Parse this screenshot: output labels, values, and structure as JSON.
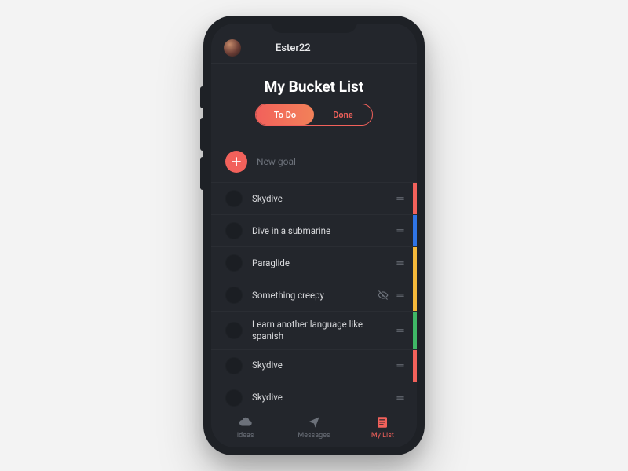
{
  "header": {
    "username": "Ester22"
  },
  "page": {
    "title": "My Bucket List"
  },
  "segments": {
    "todo": "To Do",
    "done": "Done"
  },
  "newGoal": {
    "placeholder": "New goal"
  },
  "items": [
    {
      "label": "Skydive",
      "color": "#f2615b",
      "private": false
    },
    {
      "label": "Dive in a submarine",
      "color": "#2f74e6",
      "private": false
    },
    {
      "label": "Paraglide",
      "color": "#f5b93a",
      "private": false
    },
    {
      "label": "Something creepy",
      "color": "#f5b93a",
      "private": true
    },
    {
      "label": "Learn another language like spanish",
      "color": "#3fb766",
      "private": false
    },
    {
      "label": "Skydive",
      "color": "#f2615b",
      "private": false
    },
    {
      "label": "Skydive",
      "color": "",
      "private": false
    }
  ],
  "tabs": {
    "ideas": "Ideas",
    "messages": "Messages",
    "mylist": "My List"
  }
}
